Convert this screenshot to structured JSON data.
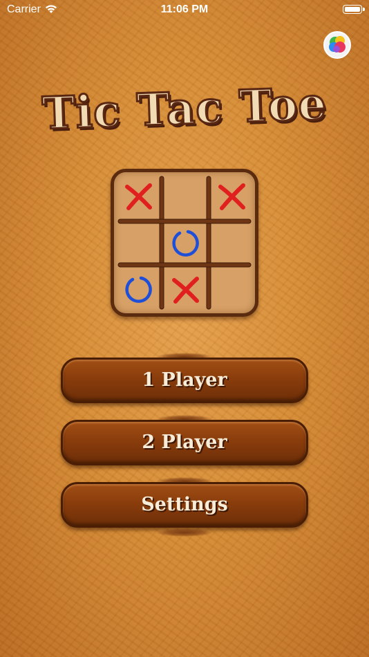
{
  "status_bar": {
    "carrier": "Carrier",
    "time": "11:06 PM",
    "wifi_icon": "wifi-icon",
    "battery_icon": "battery-icon"
  },
  "game_center_icon": "game-center-icon",
  "title": "Tic Tac Toe",
  "board": {
    "cells": [
      "X",
      "",
      "X",
      "",
      "O",
      "",
      "O",
      "X",
      ""
    ],
    "x_color": "#e0201f",
    "o_color": "#1f4fd8"
  },
  "menu": {
    "one_player": "1 Player",
    "two_player": "2 Player",
    "settings": "Settings"
  }
}
